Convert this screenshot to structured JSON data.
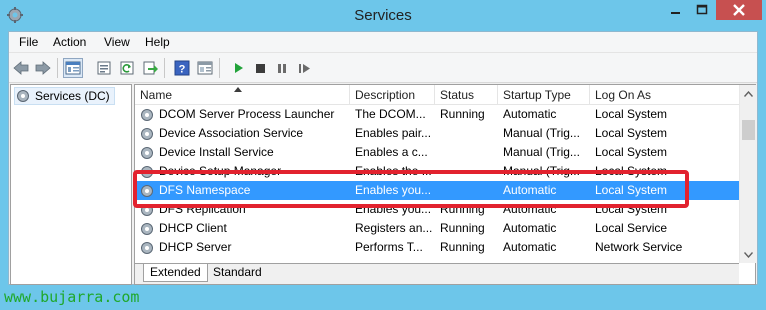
{
  "window": {
    "title": "Services"
  },
  "menu": [
    "File",
    "Action",
    "View",
    "Help"
  ],
  "toolbar": {
    "icons": [
      "back-arrow-icon",
      "forward-arrow-icon",
      "console-tree-icon",
      "properties-icon",
      "refresh-icon",
      "export-list-icon",
      "help-icon",
      "extended-view-icon",
      "start-service-icon",
      "stop-service-icon",
      "pause-service-icon",
      "restart-service-icon"
    ]
  },
  "tree": {
    "root_label": "Services (DC)"
  },
  "table": {
    "columns": [
      "Name",
      "Description",
      "Status",
      "Startup Type",
      "Log On As"
    ],
    "rows": [
      {
        "name": "DCOM Server Process Launcher",
        "description": "The DCOM...",
        "status": "Running",
        "startup": "Automatic",
        "logon": "Local System"
      },
      {
        "name": "Device Association Service",
        "description": "Enables pair...",
        "status": "",
        "startup": "Manual (Trig...",
        "logon": "Local System"
      },
      {
        "name": "Device Install Service",
        "description": "Enables a c...",
        "status": "",
        "startup": "Manual (Trig...",
        "logon": "Local System"
      },
      {
        "name": "Device Setup Manager",
        "description": "Enables the ...",
        "status": "",
        "startup": "Manual (Trig...",
        "logon": "Local System"
      },
      {
        "name": "DFS Namespace",
        "description": "Enables you...",
        "status": "",
        "startup": "Automatic",
        "logon": "Local System"
      },
      {
        "name": "DFS Replication",
        "description": "Enables you...",
        "status": "Running",
        "startup": "Automatic",
        "logon": "Local System"
      },
      {
        "name": "DHCP Client",
        "description": "Registers an...",
        "status": "Running",
        "startup": "Automatic",
        "logon": "Local Service"
      },
      {
        "name": "DHCP Server",
        "description": "Performs T...",
        "status": "Running",
        "startup": "Automatic",
        "logon": "Network Service"
      }
    ],
    "selected_index": 4
  },
  "tabs": [
    "Extended",
    "Standard"
  ],
  "active_tab": "Extended",
  "watermark": "www.bujarra.com",
  "colors": {
    "titlebar": "#6dc6ea",
    "selection": "#3399ff",
    "highlight_box": "#e2222e",
    "close_button": "#c75050",
    "watermark": "#1fa82b"
  }
}
